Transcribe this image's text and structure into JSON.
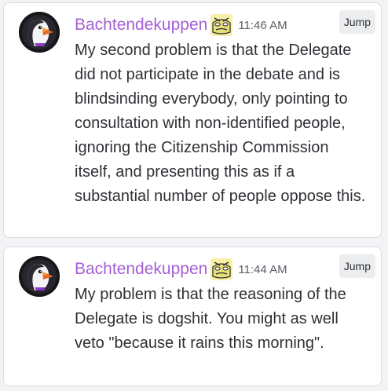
{
  "messages": [
    {
      "username": "Bachtendekuppen",
      "role_icon": "pepe-face-icon",
      "timestamp": "11:46 AM",
      "jump_label": "Jump",
      "content": "My second problem is that the Delegate did not participate in the debate and is blindsinding everybody, only pointing to consultation with non-identified people, ignoring the Citizenship Commission itself, and presenting this as if a substantial number of people oppose this."
    },
    {
      "username": "Bachtendekuppen",
      "role_icon": "pepe-face-icon",
      "timestamp": "11:44 AM",
      "jump_label": "Jump",
      "content": "My problem is that the reasoning of the Delegate is dogshit. You might as well veto \"because it rains this morning\"."
    }
  ],
  "colors": {
    "username": "#a55fd4",
    "background": "#f2f3f5",
    "card": "#ffffff",
    "text": "#2e3035",
    "timestamp": "#5c5e66"
  }
}
